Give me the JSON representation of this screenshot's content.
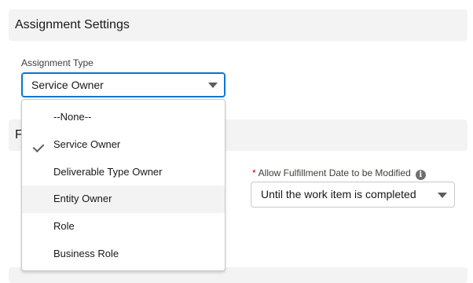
{
  "sections": {
    "assignment_settings_title": "Assignment Settings",
    "second_title_partial": "F"
  },
  "assignment_type": {
    "label": "Assignment Type",
    "selected": "Service Owner",
    "options": [
      "--None--",
      "Service Owner",
      "Deliverable Type Owner",
      "Entity Owner",
      "Role",
      "Business Role"
    ],
    "highlighted": "Entity Owner",
    "checked": "Service Owner"
  },
  "fulfillment": {
    "required_mark": "*",
    "label": "Allow Fulfillment Date to be Modified",
    "info_glyph": "i",
    "selected": "Until the work item is completed"
  },
  "icons": {
    "caret": "chevron-down-icon",
    "check": "check-icon",
    "info": "info-icon"
  },
  "colors": {
    "focus_border": "#0176d3",
    "required": "#ba0517",
    "section_bg": "#f3f3f3"
  }
}
